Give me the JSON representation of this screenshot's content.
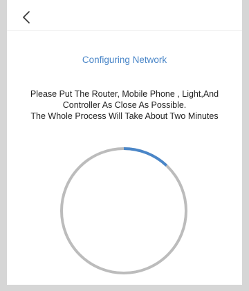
{
  "header": {
    "back_icon": "chevron-left-icon"
  },
  "title": "Configuring Network",
  "instructions": {
    "line1": "Please Put The Router, Mobile Phone ,  Light,And",
    "line2": "Controller As Close As Possible.",
    "line3": "The Whole Process Will Take About Two Minutes"
  },
  "progress": {
    "fraction": 0.12
  },
  "colors": {
    "accent": "#4a86c8",
    "track": "#bcbcbc",
    "background": "#d6d6d6"
  }
}
